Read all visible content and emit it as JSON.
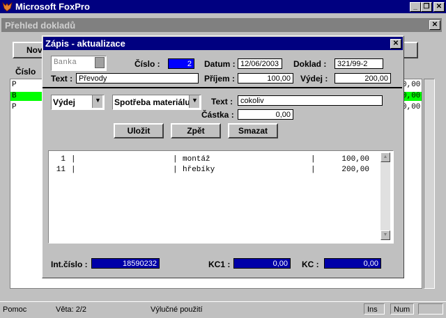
{
  "app": {
    "title": "Microsoft FoxPro"
  },
  "bg_window": {
    "title": "Přehled dokladů",
    "button_partial": "Nov",
    "column_partial": "Číslo",
    "rows": [
      {
        "left": "P",
        "right": "0,00"
      },
      {
        "left": "B",
        "right": "0,00"
      },
      {
        "left": "P",
        "right": "0,00"
      }
    ]
  },
  "dialog": {
    "title": "Zápis - aktualizace",
    "type_value": "Banka",
    "cislo_label": "Číslo :",
    "cislo_value": "2",
    "datum_label": "Datum :",
    "datum_value": "12/06/2003",
    "doklad_label": "Doklad :",
    "doklad_value": "321/99-2",
    "text_label": "Text :",
    "text_value": "Převody",
    "prijem_label": "Příjem :",
    "prijem_value": "100,00",
    "vydej_label": "Výdej :",
    "vydej_value": "200,00",
    "kind_select": "Výdej",
    "category_select": "Spotřeba materiálu",
    "text2_label": "Text :",
    "text2_value": "cokoliv",
    "castka_label": "Částka :",
    "castka_value": "0,00",
    "save_label": "Uložit",
    "back_label": "Zpět",
    "delete_label": "Smazat",
    "list_rows": [
      {
        "num": "1",
        "text": "montáž",
        "amount": "100,00"
      },
      {
        "num": "11",
        "text": "hřebíky",
        "amount": "200,00"
      }
    ],
    "intcislo_label": "Int.číslo :",
    "intcislo_value": "18590232",
    "kc1_label": "KC1 :",
    "kc1_value": "0,00",
    "kc_label": "KC :",
    "kc_value": "0,00"
  },
  "status": {
    "help": "Pomoc",
    "record": "Věta: 2/2",
    "mode": "Výlučné použití",
    "ins": "Ins",
    "num": "Num"
  }
}
